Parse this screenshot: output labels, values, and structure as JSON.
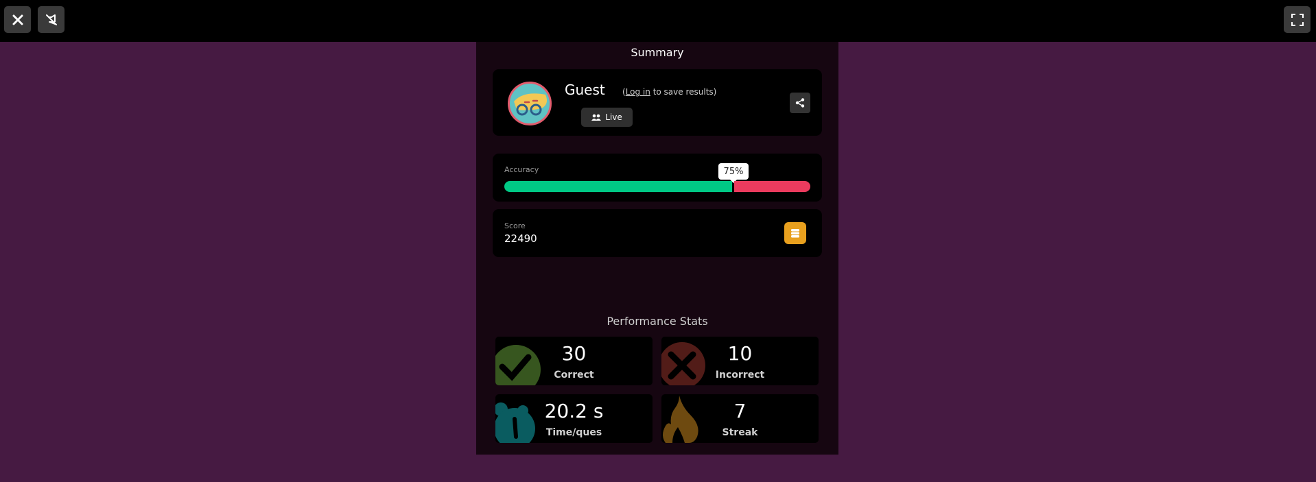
{
  "toolbar": {
    "close_icon": "close-icon",
    "sound_icon": "mute-icon",
    "fullscreen_icon": "fullscreen-icon"
  },
  "summary": {
    "title": "Summary"
  },
  "profile": {
    "name": "Guest",
    "login_open": "(",
    "login_link": "Log in",
    "login_suffix": " to save results)",
    "mode_label": "Live",
    "share_icon": "share-icon"
  },
  "accuracy": {
    "label": "Accuracy",
    "percent_text": "75%",
    "value": 0.75,
    "colors": {
      "correct": "#00c985",
      "incorrect": "#ec3b5e"
    }
  },
  "score": {
    "label": "Score",
    "value": "22490"
  },
  "performance": {
    "title": "Performance Stats",
    "stats": [
      {
        "value": "30",
        "label": "Correct",
        "icon": "check-icon"
      },
      {
        "value": "10",
        "label": "Incorrect",
        "icon": "x-icon"
      },
      {
        "value": "20.2 s",
        "label": "Time/ques",
        "icon": "timer-icon"
      },
      {
        "value": "7",
        "label": "Streak",
        "icon": "flame-icon"
      }
    ]
  }
}
